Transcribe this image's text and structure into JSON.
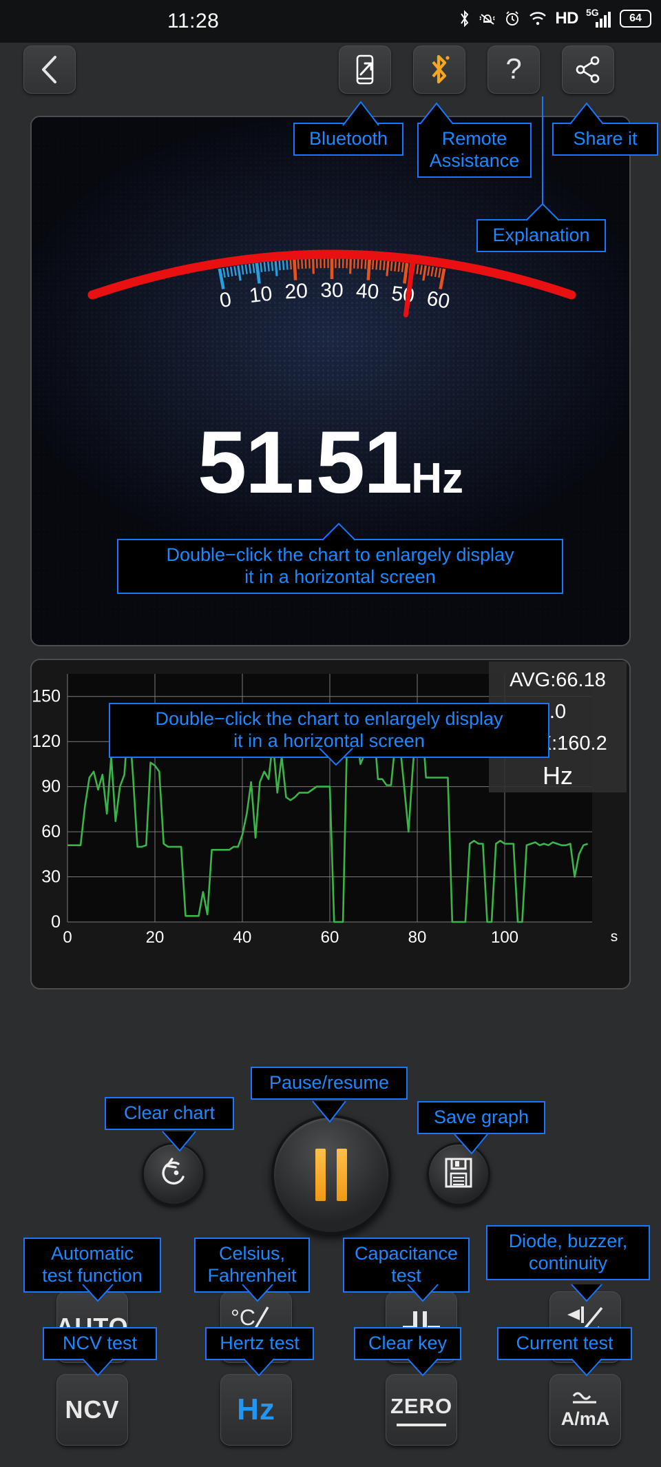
{
  "status_bar": {
    "time": "11:28",
    "battery": "64",
    "network": "5G",
    "hd": "HD",
    "icons": [
      "bluetooth-icon",
      "mute-bell-icon",
      "alarm-icon",
      "wifi-icon",
      "hd-icon",
      "5g-signal-icon",
      "battery-icon"
    ]
  },
  "toolbar": {
    "back_label": "back-arrow",
    "buttons": [
      {
        "name": "remote-assistance-button",
        "icon": "phone-arrow-icon"
      },
      {
        "name": "bluetooth-button",
        "icon": "bluetooth-icon"
      },
      {
        "name": "explanation-button",
        "icon": "question-mark-icon"
      },
      {
        "name": "share-button",
        "icon": "share-nodes-icon"
      }
    ]
  },
  "gauge": {
    "value": "51.51",
    "unit": "Hz",
    "ticks": [
      "0",
      "10",
      "20",
      "30",
      "40",
      "50",
      "60"
    ],
    "scale_min": 0,
    "scale_max": 60,
    "needle_value": 51.51,
    "colors": {
      "low": "#2a9fe0",
      "high": "#e8521d",
      "needle": "#e81010"
    }
  },
  "chart_data": {
    "type": "line",
    "title": "",
    "xlabel": "s",
    "ylabel": "",
    "ylim": [
      0,
      165
    ],
    "xlim": [
      0,
      120
    ],
    "yticks": [
      0,
      30,
      60,
      90,
      120,
      150
    ],
    "xticks": [
      0,
      20,
      40,
      60,
      80,
      100
    ],
    "grid": true,
    "series": [
      {
        "name": "Hz",
        "color": "#3ab54a",
        "x": [
          0,
          1,
          2,
          3,
          4,
          5,
          6,
          7,
          8,
          9,
          10,
          11,
          12,
          13,
          14,
          15,
          16,
          17,
          18,
          19,
          20,
          21,
          22,
          23,
          24,
          25,
          26,
          27,
          28,
          29,
          30,
          31,
          32,
          33,
          34,
          35,
          36,
          37,
          38,
          39,
          40,
          41,
          42,
          43,
          44,
          45,
          46,
          47,
          48,
          49,
          50,
          51,
          52,
          53,
          54,
          55,
          56,
          57,
          58,
          59,
          60,
          61,
          62,
          63,
          64,
          65,
          66,
          67,
          68,
          69,
          70,
          71,
          72,
          73,
          74,
          75,
          76,
          77,
          78,
          79,
          80,
          81,
          82,
          83,
          84,
          85,
          86,
          87,
          88,
          89,
          90,
          91,
          92,
          93,
          94,
          95,
          96,
          97,
          98,
          99,
          100,
          101,
          102,
          103,
          104,
          105,
          106,
          107,
          108,
          109,
          110,
          111,
          112,
          113,
          114,
          115,
          116,
          117,
          118,
          119
        ],
        "values": [
          51,
          51,
          51,
          51,
          77,
          96,
          100,
          88,
          98,
          72,
          110,
          67,
          90,
          98,
          137,
          96,
          50,
          50,
          51,
          106,
          104,
          100,
          52,
          50,
          50,
          50,
          50,
          4,
          4,
          4,
          4,
          20,
          5,
          48,
          48,
          48,
          48,
          48,
          50,
          50,
          58,
          72,
          93,
          56,
          93,
          100,
          95,
          120,
          86,
          110,
          83,
          81,
          83,
          86,
          86,
          86,
          88,
          90,
          90,
          90,
          90,
          0,
          0,
          0,
          130,
          127,
          130,
          105,
          112,
          130,
          132,
          95,
          95,
          91,
          91,
          120,
          119,
          90,
          60,
          103,
          138,
          138,
          96,
          96,
          96,
          96,
          96,
          96,
          0,
          0,
          0,
          0,
          52,
          54,
          52,
          52,
          0,
          0,
          52,
          54,
          52,
          52,
          52,
          0,
          0,
          51,
          52,
          53,
          51,
          52,
          51,
          53,
          52,
          51,
          51,
          52,
          30,
          45,
          51,
          52
        ]
      }
    ],
    "stats": {
      "avg_label": "AVG:66.18",
      "min_label": ".0",
      "max_label": "MAX:160.2",
      "unit": "Hz"
    }
  },
  "controls": {
    "clear_chart": {
      "label": "Clear chart",
      "icon": "undo-arrow-icon"
    },
    "pause_resume": {
      "label": "Pause/resume",
      "icon": "pause-icon"
    },
    "save_graph": {
      "label": "Save graph",
      "icon": "floppy-disk-icon"
    }
  },
  "keys": [
    {
      "name": "auto-button",
      "text": "AUTO",
      "callout": "Automatic\ntest function"
    },
    {
      "name": "celsius-fahrenheit-button",
      "text": "°C/°F",
      "callout": "Celsius,\nFahrenheit"
    },
    {
      "name": "capacitance-button",
      "text": "capacitor-icon",
      "callout": "Capacitance\ntest"
    },
    {
      "name": "diode-buzzer-button",
      "text": "diode-buzzer-icon",
      "callout": "Diode, buzzer,\ncontinuity"
    },
    {
      "name": "ncv-button",
      "text": "NCV",
      "callout": "NCV test"
    },
    {
      "name": "hertz-button",
      "text": "Hz",
      "callout": "Hertz test"
    },
    {
      "name": "zero-button",
      "text": "ZERO",
      "callout": "Clear key"
    },
    {
      "name": "current-button",
      "text": "A/mA",
      "callout": "Current test"
    }
  ],
  "callouts": {
    "bluetooth": "Bluetooth",
    "remote_assistance": "Remote\nAssistance",
    "share_it": "Share it",
    "explanation": "Explanation",
    "gauge_hint": "Double−click the chart to enlargely display\nit in a horizontal screen",
    "chart_hint": "Double−click the chart to enlargely display\nit in a horizontal screen",
    "clear_chart": "Clear chart",
    "pause_resume": "Pause/resume",
    "save_graph": "Save graph"
  }
}
